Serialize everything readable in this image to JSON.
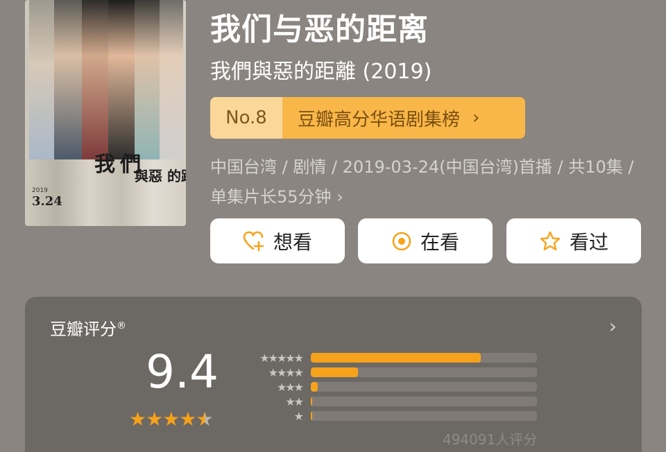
{
  "poster": {
    "title_char1": "我",
    "title_char2": "們",
    "title_rest": "與惡 的距離",
    "year": "2019",
    "date": "3.24"
  },
  "show": {
    "title": "我们与恶的距离",
    "original_title": "我們與惡的距離 (2019)"
  },
  "rank": {
    "number": "No.8",
    "label": "豆瓣高分华语剧集榜",
    "chevron": "›",
    "bg_colors": [
      "#fbd79a",
      "#f9b749"
    ]
  },
  "meta": {
    "text": "中国台湾 / 剧情 / 2019-03-24(中国台湾)首播 / 共10集 / 单集片长55分钟",
    "chevron": "›"
  },
  "actions": [
    {
      "label": "想看",
      "icon": "heart-plus-icon"
    },
    {
      "label": "在看",
      "icon": "target-icon"
    },
    {
      "label": "看过",
      "icon": "star-outline-icon"
    }
  ],
  "rating": {
    "title": "豆瓣评分",
    "registered": "®",
    "score": "9.4",
    "stars_value": 4.5,
    "count_text": "494091人评分",
    "accent_color": "#f7a21b",
    "distribution": [
      {
        "stars": "★★★★★",
        "fraction": 0.75
      },
      {
        "stars": "★★★★",
        "fraction": 0.21
      },
      {
        "stars": "★★★",
        "fraction": 0.03
      },
      {
        "stars": "★★",
        "fraction": 0.005
      },
      {
        "stars": "★",
        "fraction": 0.005
      }
    ]
  }
}
